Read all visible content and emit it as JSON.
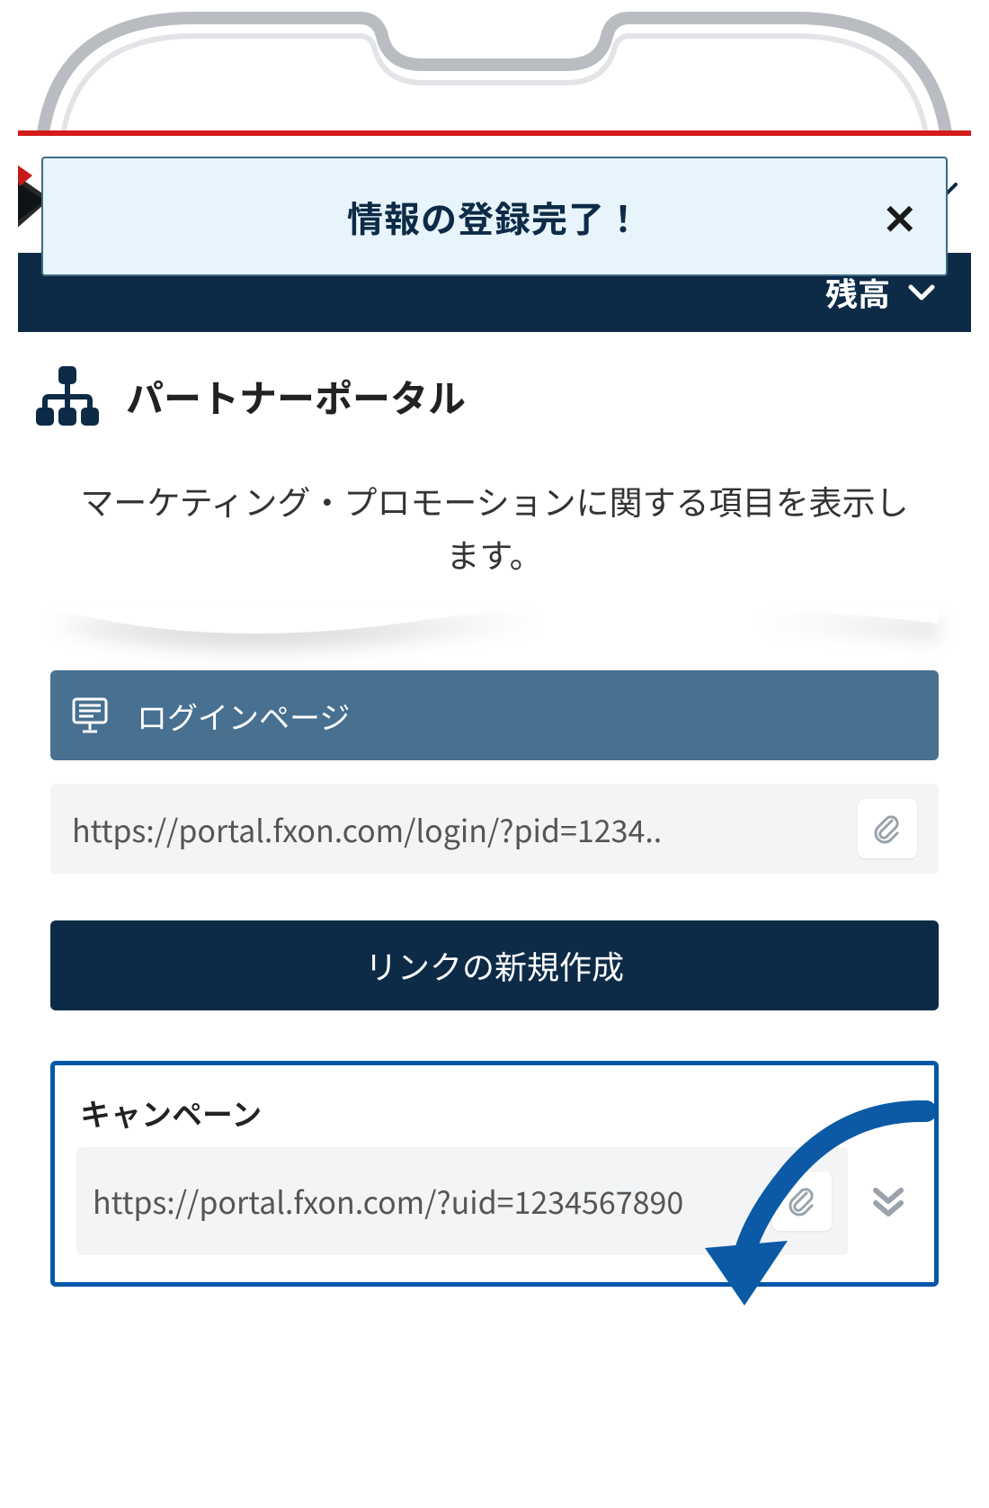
{
  "toast": {
    "title": "情報の登録完了！"
  },
  "balance": {
    "label": "残高"
  },
  "section": {
    "title": "パートナーポータル",
    "description": "マーケティング・プロモーションに関する項目を表示します。"
  },
  "login_block": {
    "header_label": "ログインページ",
    "url": "https://portal.fxon.com/login/?pid=1234.."
  },
  "create_link": {
    "label": "リンクの新規作成"
  },
  "campaign": {
    "title": "キャンペーン",
    "url": "https://portal.fxon.com/?uid=1234567890"
  }
}
